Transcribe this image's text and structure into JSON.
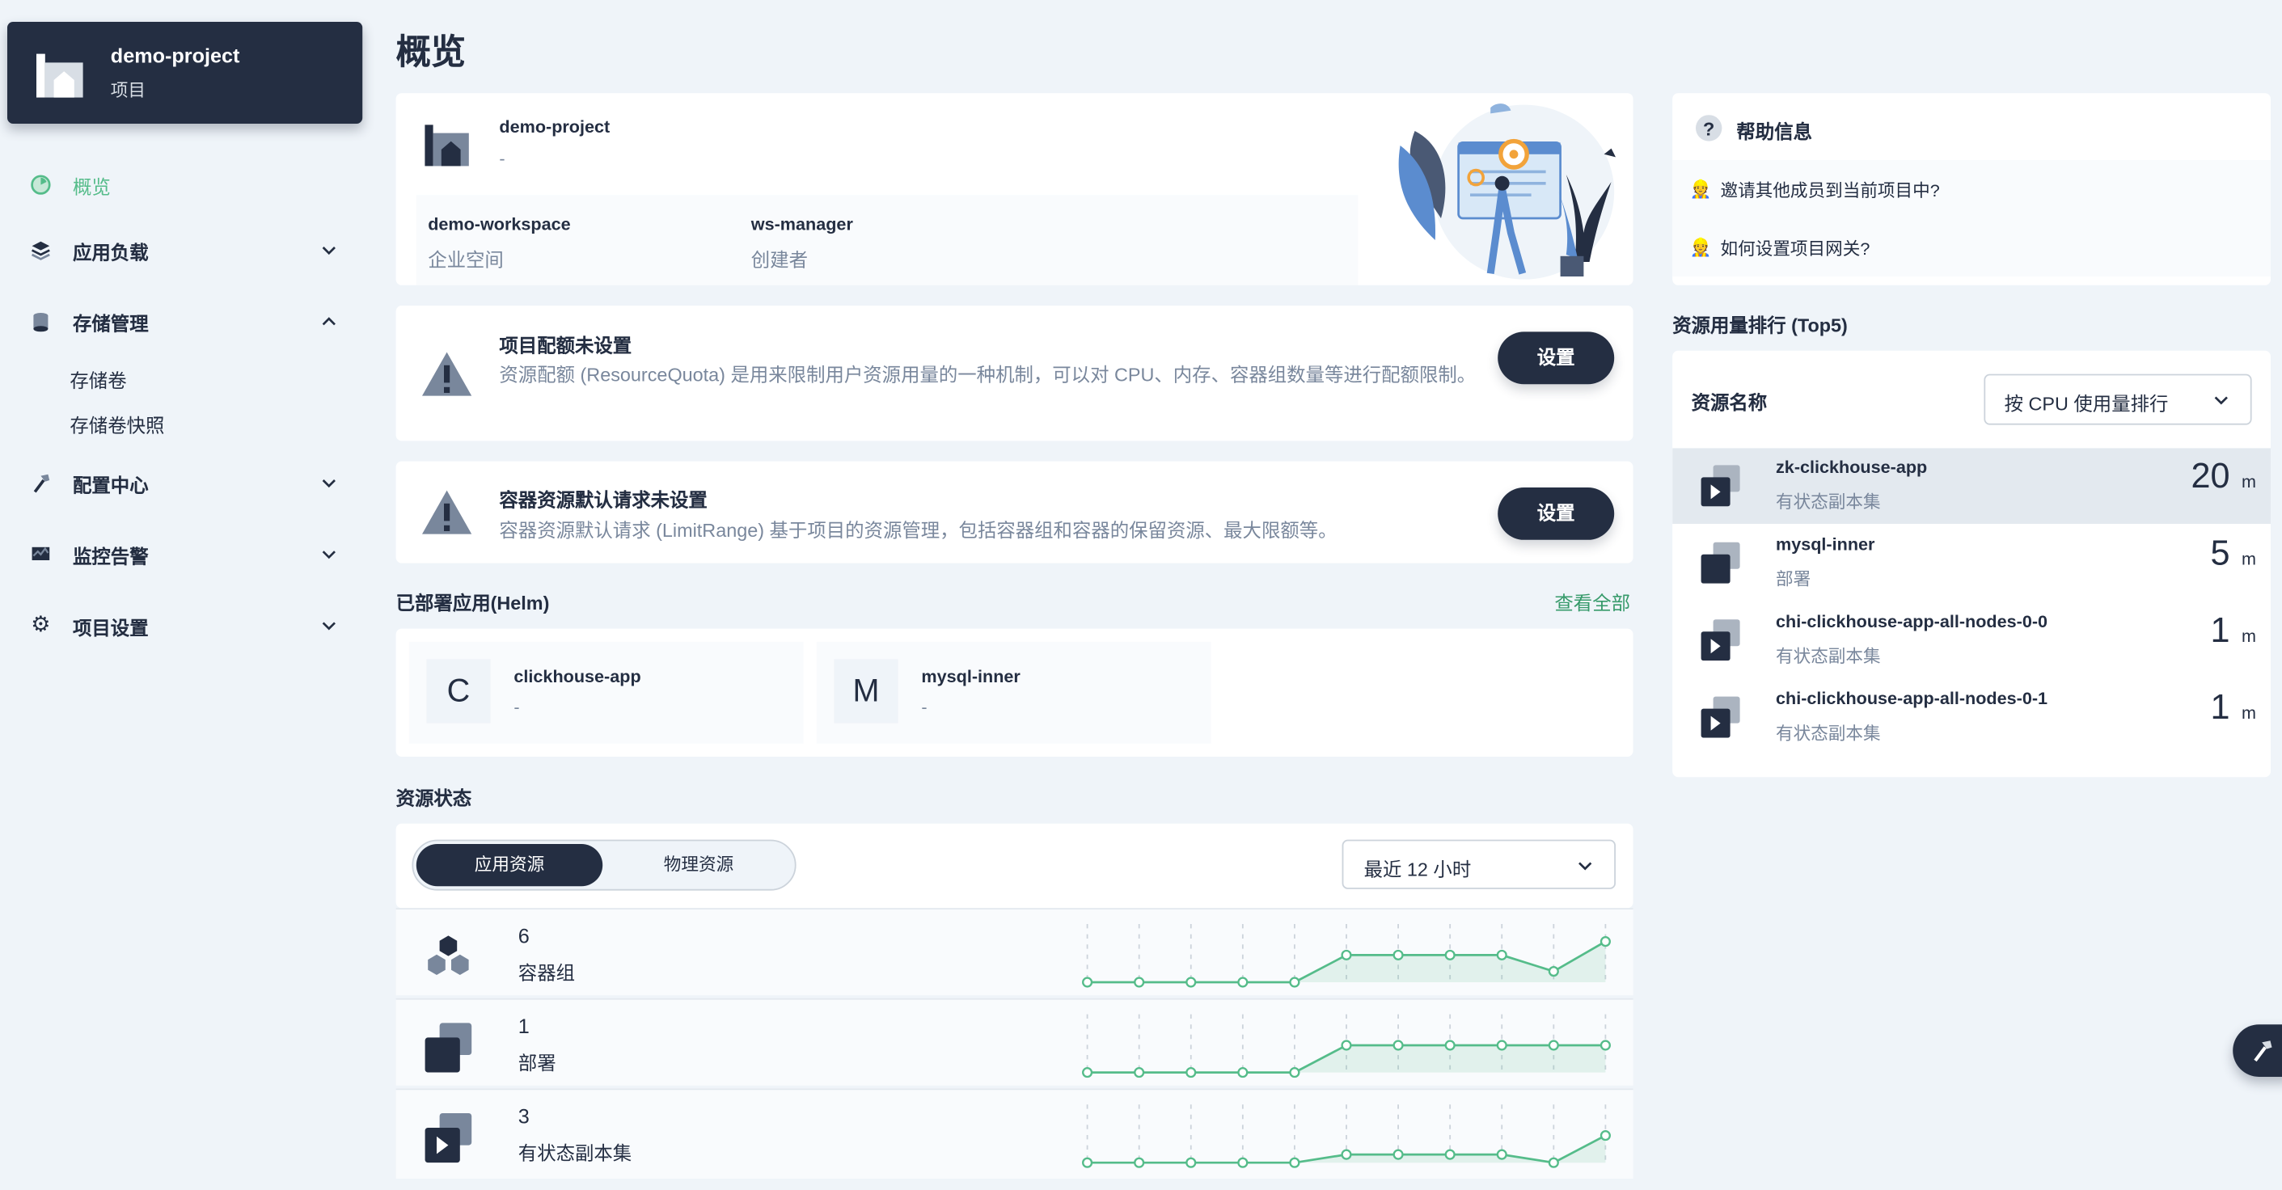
{
  "project": {
    "name": "demo-project",
    "type_label": "项目"
  },
  "sidebar": {
    "items": [
      {
        "label": "概览",
        "icon": "dashboard-icon",
        "active": true
      },
      {
        "label": "应用负载",
        "icon": "layers-icon"
      },
      {
        "label": "存储管理",
        "icon": "storage-icon",
        "expanded": true,
        "children": [
          "存储卷",
          "存储卷快照"
        ]
      },
      {
        "label": "配置中心",
        "icon": "hammer-icon"
      },
      {
        "label": "监控告警",
        "icon": "monitor-icon"
      },
      {
        "label": "项目设置",
        "icon": "gear-icon"
      }
    ]
  },
  "page_title": "概览",
  "info": {
    "name": "demo-project",
    "desc": "-",
    "workspace": "demo-workspace",
    "workspace_label": "企业空间",
    "creator": "ws-manager",
    "creator_label": "创建者"
  },
  "quota_warning": {
    "title": "项目配额未设置",
    "desc": "资源配额 (ResourceQuota) 是用来限制用户资源用量的一种机制，可以对 CPU、内存、容器组数量等进行配额限制。",
    "button": "设置"
  },
  "limit_warning": {
    "title": "容器资源默认请求未设置",
    "desc": "容器资源默认请求 (LimitRange) 基于项目的资源管理，包括容器组和容器的保留资源、最大限额等。",
    "button": "设置"
  },
  "helm": {
    "title": "已部署应用(Helm)",
    "view_all": "查看全部",
    "apps": [
      {
        "initial": "C",
        "name": "clickhouse-app",
        "desc": "-"
      },
      {
        "initial": "M",
        "name": "mysql-inner",
        "desc": "-"
      }
    ]
  },
  "resource_status": {
    "title": "资源状态",
    "tab_active": "应用资源",
    "tab_inactive": "物理资源",
    "time_range": "最近 12 小时",
    "rows": [
      {
        "count": "6",
        "label": "容器组",
        "icon": "pods-icon",
        "trend": [
          0,
          0,
          0,
          0,
          0,
          1,
          1,
          1,
          1,
          0.4,
          1.5
        ]
      },
      {
        "count": "1",
        "label": "部署",
        "icon": "deployment-icon",
        "trend": [
          0,
          0,
          0,
          0,
          0,
          1,
          1,
          1,
          1,
          1,
          1
        ]
      },
      {
        "count": "3",
        "label": "有状态副本集",
        "icon": "statefulset-icon",
        "trend": [
          0,
          0,
          0,
          0,
          0,
          0.3,
          0.3,
          0.3,
          0.3,
          0,
          1
        ]
      }
    ],
    "color": "#55bc8a"
  },
  "help": {
    "title": "帮助信息",
    "items": [
      "邀请其他成员到当前项目中?",
      "如何设置项目网关?"
    ]
  },
  "ranking": {
    "title": "资源用量排行 (Top5)",
    "column": "资源名称",
    "sort_by": "按 CPU 使用量排行",
    "rows": [
      {
        "name": "zk-clickhouse-app",
        "type": "有状态副本集",
        "value": "20",
        "unit": "m",
        "icon": "statefulset-icon"
      },
      {
        "name": "mysql-inner",
        "type": "部署",
        "value": "5",
        "unit": "m",
        "icon": "deployment-icon"
      },
      {
        "name": "chi-clickhouse-app-all-nodes-0-0",
        "type": "有状态副本集",
        "value": "1",
        "unit": "m",
        "icon": "statefulset-icon"
      },
      {
        "name": "chi-clickhouse-app-all-nodes-0-1",
        "type": "有状态副本集",
        "value": "1",
        "unit": "m",
        "icon": "statefulset-icon"
      }
    ]
  },
  "floating_tool": {
    "icon": "hammer-icon"
  }
}
